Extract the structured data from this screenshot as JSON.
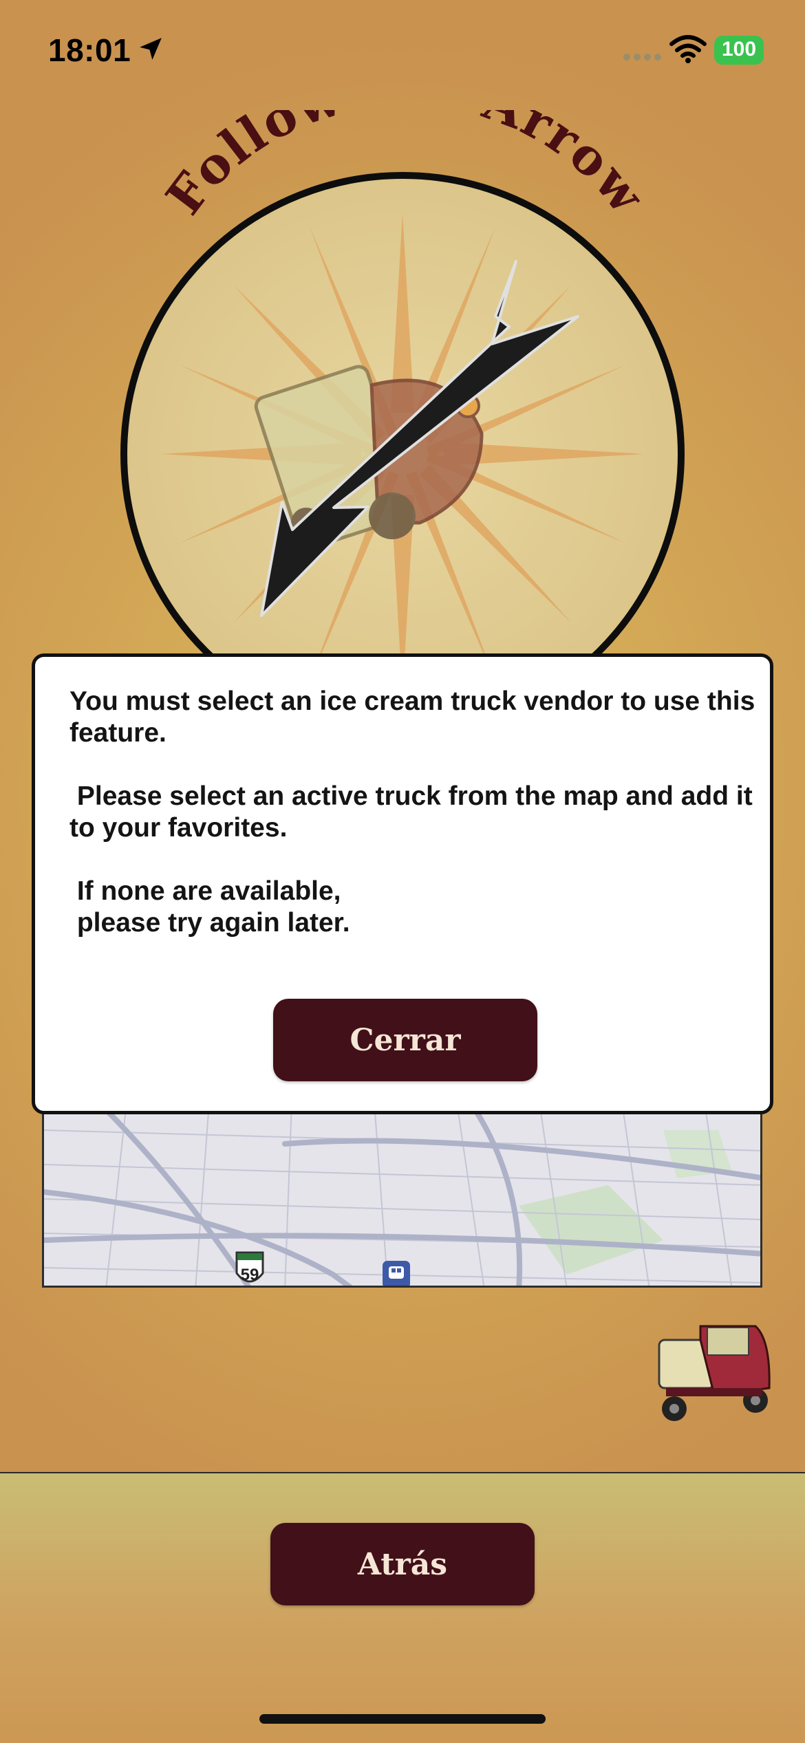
{
  "status_bar": {
    "time": "18:01",
    "battery": "100",
    "icons": [
      "location-arrow-icon",
      "cellular-signal-icon",
      "wifi-icon",
      "battery-icon"
    ]
  },
  "header": {
    "title": "Follow the Arrow"
  },
  "modal": {
    "message": "You must select an ice cream truck vendor to use this feature.\n\n Please select an active truck from the map and add it to your favorites.\n\n If none are available,\n please try again later.",
    "close_label": "Cerrar"
  },
  "map": {
    "route_shield": "59",
    "transit_icon": "train-station-icon"
  },
  "footer": {
    "back_label": "Atrás"
  },
  "colors": {
    "button_bg": "#411019",
    "battery": "#3ac24f",
    "title": "#4a0f12"
  }
}
